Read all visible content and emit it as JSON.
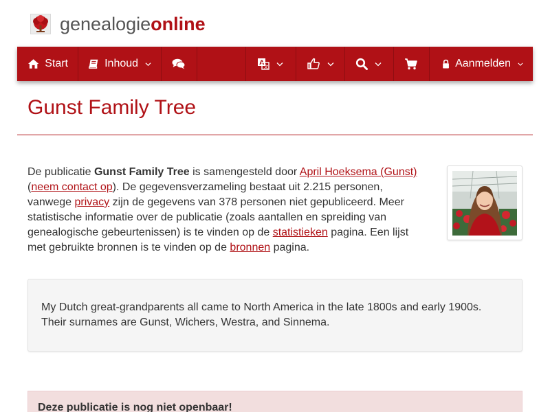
{
  "header": {
    "brand_part1": "genealogie",
    "brand_part2": "online",
    "logo_icon": "tree-icon",
    "brand_color": "#b01116"
  },
  "navbar": {
    "start_label": "Start",
    "inhoud_label": "Inhoud",
    "aanmelden_label": "Aanmelden",
    "icons": [
      "home-icon",
      "book-icon",
      "comments-icon",
      "translate-icon",
      "thumbs-up-icon",
      "search-icon",
      "cart-icon",
      "lock-icon"
    ]
  },
  "page": {
    "title": "Gunst Family Tree",
    "intro": {
      "t1": "De publicatie ",
      "pub_name": "Gunst Family Tree",
      "t2": " is samengesteld door ",
      "author_link": "April Hoeksema (Gunst)",
      "t3": " (",
      "contact_link": "neem contact op",
      "t4": "). De gegevensverzameling bestaat uit 2.215 personen, vanwege ",
      "privacy_link": "privacy",
      "t5": " zijn de gegevens van 378 personen niet gepubliceerd. Meer statistische informatie over de publicatie (zoals aantallen en spreiding van genealogische gebeurtenissen) is te vinden op de ",
      "stats_link": "statistieken",
      "t6": " pagina. Een lijst met gebruikte bronnen is te vinden op de ",
      "sources_link": "bronnen",
      "t7": " pagina."
    },
    "description": "My Dutch great-grandparents all came to North America in the late 1800s and early 1900s. Their surnames are Gunst, Wichers, Westra, and Sinnema.",
    "alert": "Deze publicatie is nog niet openbaar!"
  }
}
